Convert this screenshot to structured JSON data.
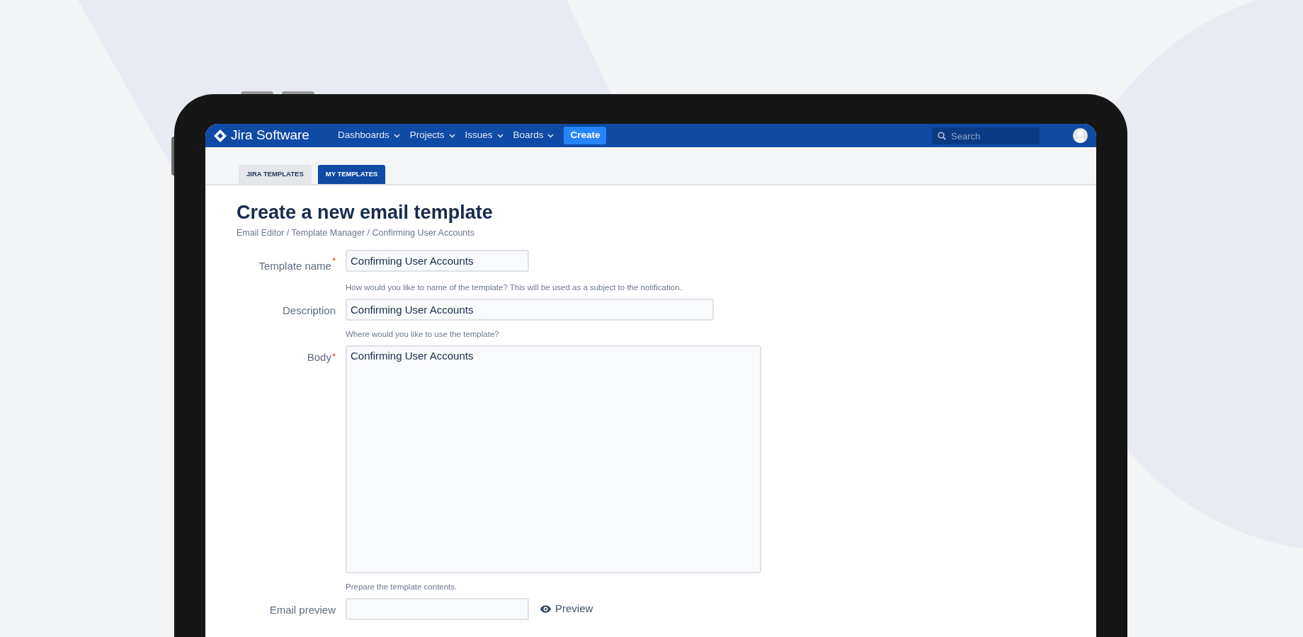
{
  "nav": {
    "logo": "Jira Software",
    "menus": [
      {
        "label": "Dashboards"
      },
      {
        "label": "Projects"
      },
      {
        "label": "Issues"
      },
      {
        "label": "Boards"
      }
    ],
    "create": "Create",
    "search": {
      "placeholder": "Search"
    }
  },
  "tabs": [
    {
      "label": "JIRA TEMPLATES",
      "selected": false
    },
    {
      "label": "MY TEMPLATES",
      "selected": true
    }
  ],
  "title": "Create a new email template",
  "breadcrumb": "Email Editor / Template Manager / Confirming User Accounts",
  "fields": [
    {
      "kind": "input",
      "label": "Template name",
      "required_mark": "*",
      "value": "Confirming User Accounts",
      "help": "How would you like to name of the template? This will be used as a subject to the notification."
    },
    {
      "kind": "input",
      "label": "Description",
      "value": "Confirming User Accounts",
      "help": "Where would you like to use the template?"
    },
    {
      "kind": "textarea",
      "label": "Body",
      "required_mark": "*",
      "value": "Confirming User Accounts",
      "help": "Prepare the template contents."
    },
    {
      "kind": "input",
      "label": "Email preview",
      "action": "Preview"
    }
  ]
}
